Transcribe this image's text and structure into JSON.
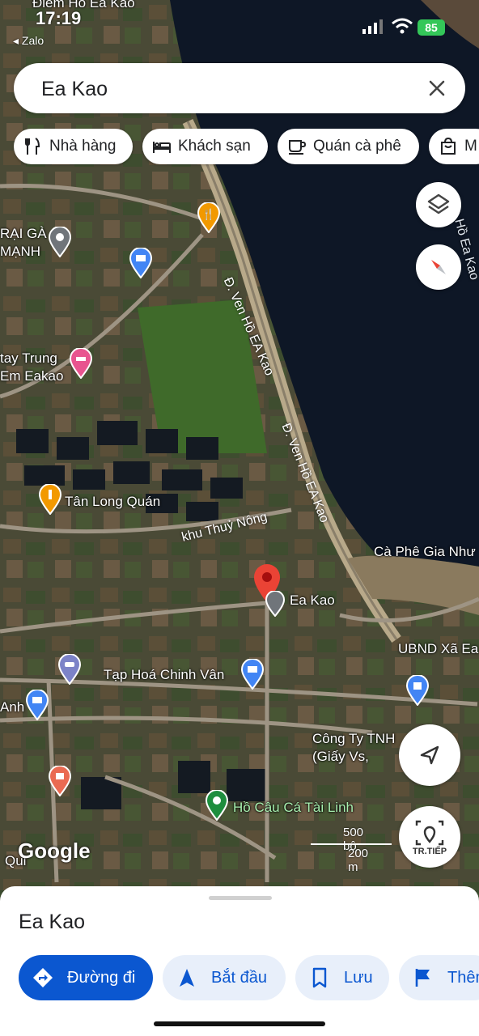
{
  "status": {
    "time": "17:19",
    "back_label": "◂ Zalo",
    "battery": "85"
  },
  "search": {
    "query": "Ea Kao"
  },
  "chips": [
    {
      "label": "Nhà hàng",
      "icon": "fork-knife-icon"
    },
    {
      "label": "Khách sạn",
      "icon": "bed-icon"
    },
    {
      "label": "Quán cà phê",
      "icon": "coffee-icon"
    },
    {
      "label": "M",
      "icon": "shopping-bag-icon"
    }
  ],
  "map": {
    "labels": {
      "top_place": "Điểm Hồ Ea Kao",
      "trai_ga": "RẠI GÀ\nMẠNH",
      "nha_tro": "tay Trung\nEm Eakao",
      "tan_long": "Tân Long Quán",
      "khu_thuy_nong": "khu Thuỷ Nông",
      "road1": "Đ. Ven Hồ EA Kao",
      "road2": "Đ. Ven Hồ EA Kao",
      "ho_ea_kao": "Hồ Ea Kao",
      "ca_phe": "Cà Phê Gia Như",
      "ea_kao": "Ea Kao",
      "ubnd": "UBND Xã Ea",
      "tap_hoa": "Tạp Hoá Chinh Vân",
      "anh": "Anh",
      "cong_ty": "Công Ty TNH      Vỹ\n(Giấy Vs,        ...)",
      "ho_cau": "Hồ Câu Cá Tài Linh",
      "qui": "Qui"
    },
    "scale": {
      "feet": "500 bộ",
      "meters": "200 m"
    },
    "google": "Google",
    "next_label": "TR.TIẾP"
  },
  "sheet": {
    "title": "Ea Kao",
    "actions": [
      {
        "label": "Đường đi",
        "icon": "directions-icon"
      },
      {
        "label": "Bắt đầu",
        "icon": "navigation-arrow-icon"
      },
      {
        "label": "Lưu",
        "icon": "bookmark-icon"
      },
      {
        "label": "Thêm",
        "icon": "flag-icon"
      }
    ]
  },
  "colors": {
    "primary": "#0b57d0",
    "primary_light": "#e8effa",
    "pin_red": "#ea4335"
  }
}
